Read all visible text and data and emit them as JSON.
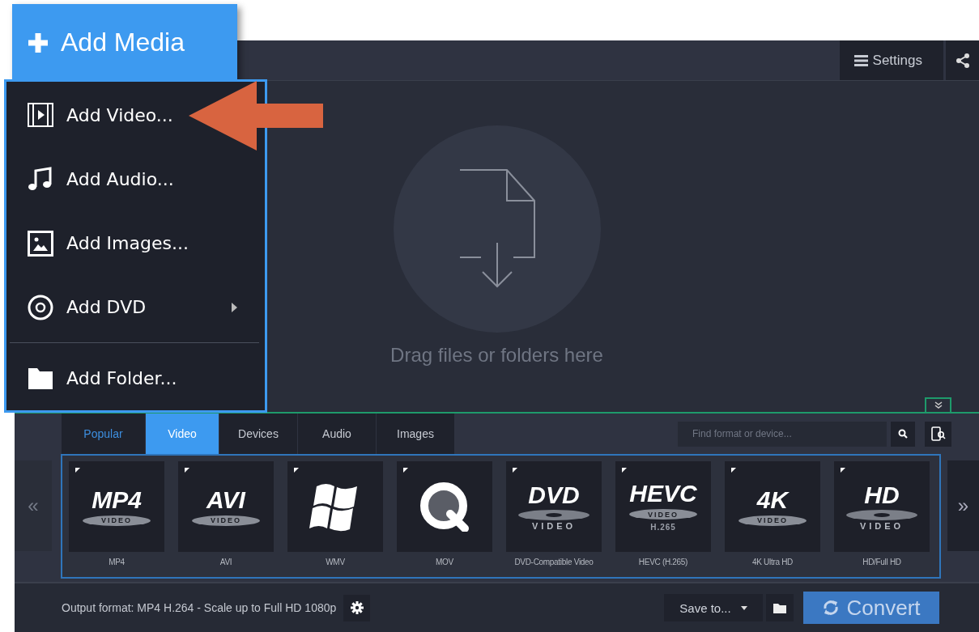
{
  "add_media": {
    "label": "Add Media"
  },
  "menu": {
    "items": [
      {
        "kind": "video",
        "label": "Add Video..."
      },
      {
        "kind": "audio",
        "label": "Add Audio...",
        "submenu": false
      },
      {
        "kind": "images",
        "label": "Add Images...",
        "submenu": false
      },
      {
        "kind": "dvd",
        "label": "Add DVD",
        "submenu": true
      },
      {
        "kind": "separator"
      },
      {
        "kind": "folder",
        "label": "Add Folder...",
        "submenu": false
      }
    ]
  },
  "toolbar": {
    "settings": "Settings"
  },
  "drop_zone": {
    "hint": "Drag files or folders here"
  },
  "format_tabs": [
    {
      "label": "Popular",
      "selected": false,
      "highlighted": true
    },
    {
      "label": "Video",
      "selected": true,
      "highlighted": false
    },
    {
      "label": "Devices",
      "selected": false,
      "highlighted": false
    },
    {
      "label": "Audio",
      "selected": false,
      "highlighted": false
    },
    {
      "label": "Images",
      "selected": false,
      "highlighted": false
    }
  ],
  "search": {
    "placeholder": "Find format or device..."
  },
  "formats": [
    {
      "kind": "disc",
      "logo": "MP4",
      "disc": "VIDEO",
      "label": "MP4"
    },
    {
      "kind": "disc",
      "logo": "AVI",
      "disc": "VIDEO",
      "label": "AVI"
    },
    {
      "kind": "windows",
      "label": "WMV"
    },
    {
      "kind": "quicktime",
      "label": "MOV"
    },
    {
      "kind": "dvd",
      "logo": "DVD",
      "sub": "VIDEO",
      "label": "DVD-Compatible Video"
    },
    {
      "kind": "disc",
      "logo": "HEVC",
      "disc": "VIDEO",
      "extra": "H.265",
      "label": "HEVC (H.265)"
    },
    {
      "kind": "disc",
      "logo": "4K",
      "disc": "VIDEO",
      "label": "4K Ultra HD"
    },
    {
      "kind": "dvd",
      "logo": "HD",
      "sub": "VIDEO",
      "label": "HD/Full HD"
    }
  ],
  "nav": {
    "prev": "«",
    "next": "»"
  },
  "bottom": {
    "output_format": "Output format: MP4 H.264 - Scale up to Full HD 1080p",
    "save_to": "Save to...",
    "convert": "Convert"
  }
}
